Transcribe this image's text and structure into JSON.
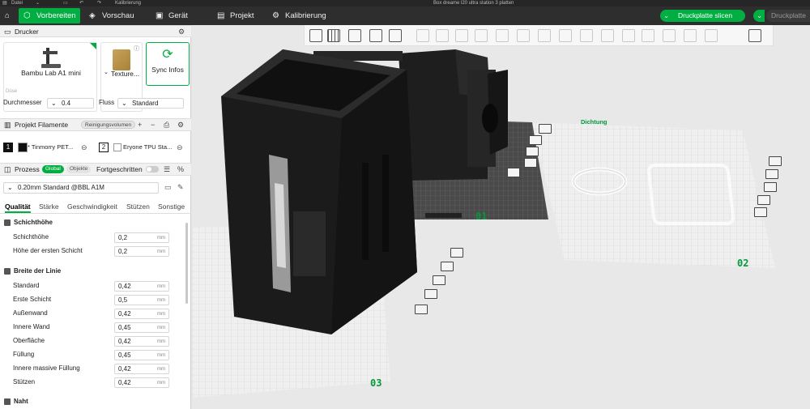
{
  "titlebar": {
    "menu_label": "Datei",
    "calibration_label": "Kalibrierung",
    "window_title": "Box dreame l20 ultra station 3 platten"
  },
  "tabs": [
    {
      "label": "Vorbereiten",
      "icon": "cube-icon"
    },
    {
      "label": "Vorschau",
      "icon": "layers-icon"
    },
    {
      "label": "Gerät",
      "icon": "device-icon"
    },
    {
      "label": "Projekt",
      "icon": "project-icon"
    },
    {
      "label": "Kalibrierung",
      "icon": "calibrate-icon"
    }
  ],
  "actions": {
    "slice_plate": "Druckplatte slicen",
    "print_plate": "Druckplatte"
  },
  "printer": {
    "header": "Drucker",
    "name": "Bambu Lab A1 mini",
    "plate": "Texture...",
    "sync": "Sync Infos",
    "nozzle_label": "Düse",
    "diameter_label": "Durchmesser",
    "diameter_value": "0.4",
    "flow_label": "Fluss",
    "flow_value": "Standard"
  },
  "filaments": {
    "header": "Projekt Filamente",
    "flush_label": "Reinigungsvolumen",
    "items": [
      {
        "index": "1",
        "name": "* Tinmorry PET...",
        "color": "#111111"
      },
      {
        "index": "2",
        "name": "Eryone TPU Sta...",
        "color": "#ffffff"
      }
    ]
  },
  "process": {
    "header": "Prozess",
    "global": "Global",
    "objects": "Objekte",
    "advanced": "Fortgeschritten",
    "profile": "0.20mm Standard @BBL A1M",
    "tabs": [
      "Qualität",
      "Stärke",
      "Geschwindigkeit",
      "Stützen",
      "Sonstige"
    ],
    "groups": {
      "layer_height": "Schichthöhe",
      "line_width": "Breite der Linie",
      "seam": "Naht"
    },
    "unit": "mm",
    "layer_rows": [
      {
        "label": "Schichthöhe",
        "value": "0,2"
      },
      {
        "label": "Höhe der ersten Schicht",
        "value": "0,2"
      }
    ],
    "width_rows": [
      {
        "label": "Standard",
        "value": "0,42"
      },
      {
        "label": "Erste Schicht",
        "value": "0,5"
      },
      {
        "label": "Außenwand",
        "value": "0,42"
      },
      {
        "label": "Innere Wand",
        "value": "0,45"
      },
      {
        "label": "Oberfläche",
        "value": "0,42"
      },
      {
        "label": "Füllung",
        "value": "0,45"
      },
      {
        "label": "Innere massive Füllung",
        "value": "0,42"
      },
      {
        "label": "Stützen",
        "value": "0,42"
      }
    ]
  },
  "viewport": {
    "plates": [
      "01",
      "02",
      "03"
    ],
    "plate2_object_label": "Dichtung"
  },
  "colors": {
    "accent": "#00ae42",
    "dark_bar": "#2e2e2e",
    "model": "#1c1c1c"
  }
}
